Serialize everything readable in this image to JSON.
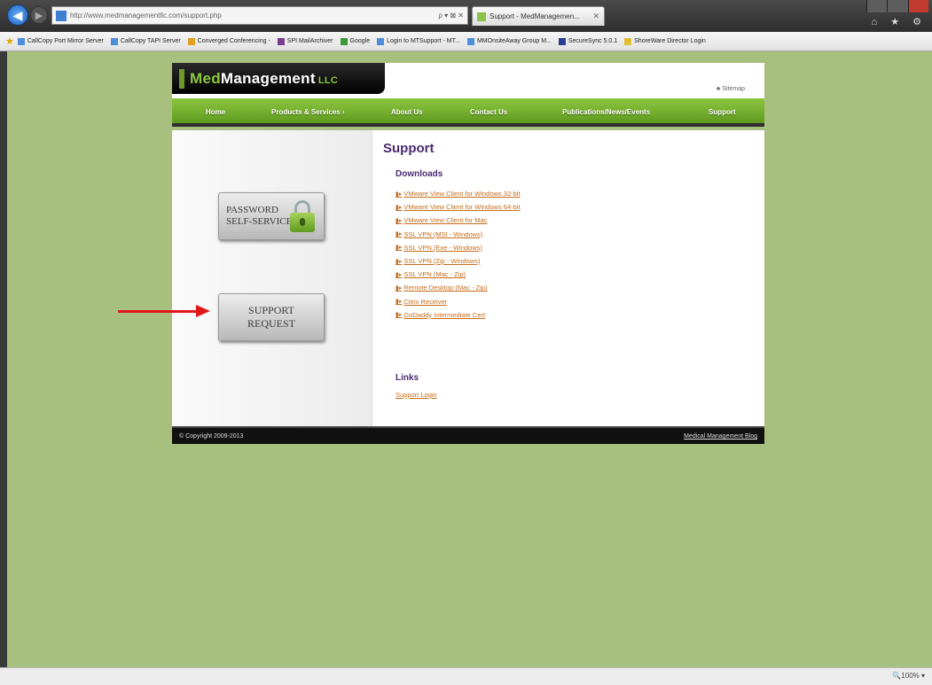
{
  "browser": {
    "address_url": "http://www.medmanagementllc.com/support.php",
    "address_tools": "ρ ▾ ⊠ ✕",
    "tab_title": "Support - MedManagemen...",
    "tab_close": "✕",
    "toolbar_icons": "⌂ ★ ⚙",
    "zoom": "🔍100% ▾"
  },
  "favorites": [
    {
      "label": "CallCopy Port Mirror Server"
    },
    {
      "label": "CallCopy TAPI Server"
    },
    {
      "label": "Converged Conferencing -"
    },
    {
      "label": "SPI MailArchiver"
    },
    {
      "label": "Google"
    },
    {
      "label": "Login to MTSupport - MT..."
    },
    {
      "label": "MMOnsiteAway Group M..."
    },
    {
      "label": "SecureSync 5.0.1"
    },
    {
      "label": "ShoreWare Director Login"
    }
  ],
  "site": {
    "logo_med": "Med",
    "logo_management": "Management",
    "logo_llc": "LLC",
    "sitemap": "Sitemap",
    "menu": [
      {
        "label": "Home"
      },
      {
        "label": "Products & Services ›"
      },
      {
        "label": "About Us"
      },
      {
        "label": "Contact Us"
      },
      {
        "label": "Publications/News/Events"
      },
      {
        "label": "Support"
      }
    ],
    "sidebar": {
      "password_line1": "PASSWORD",
      "password_line2": "SELF-SERVICE",
      "support_line1": "SUPPORT",
      "support_line2": "REQUEST"
    },
    "main": {
      "title": "Support",
      "downloads_title": "Downloads",
      "downloads": [
        "VMware View Client for Windows 32-bit",
        "VMware View Client for Windows 64-bit",
        "VMware View Client for Mac",
        "SSL VPN (MSI - Windows)",
        "SSL VPN (Exe - Windows)",
        "SSL VPN (Zip - Windows)",
        "SSL VPN (Mac - Zip)",
        "Remote Desktop (Mac - Zip)",
        "Citrix Receiver",
        "GoDaddy Intermediate Cert"
      ],
      "links_title": "Links",
      "support_login": "Support Login"
    },
    "footer": {
      "copyright": "© Copyright 2009-2013",
      "blog": "Medical Management Blog"
    }
  },
  "colors": {
    "page_bg": "#a8c07e",
    "menu_green": "#8cc63f",
    "heading_purple": "#4a2a72",
    "link_orange": "#c46c1a",
    "annotation_red": "#e3171b"
  }
}
